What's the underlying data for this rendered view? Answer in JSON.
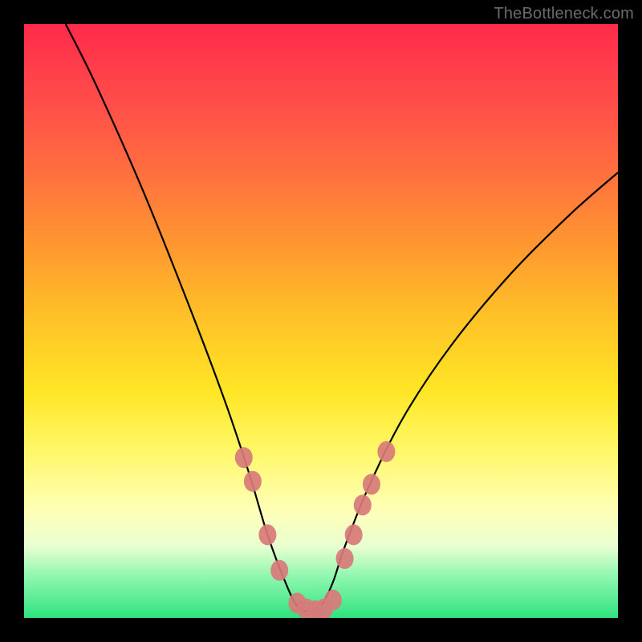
{
  "watermark": "TheBottleneck.com",
  "chart_data": {
    "type": "line",
    "title": "",
    "xlabel": "",
    "ylabel": "",
    "xlim": [
      0,
      100
    ],
    "ylim": [
      0,
      100
    ],
    "series": [
      {
        "name": "bottleneck-curve",
        "x": [
          7,
          12,
          20,
          28,
          34,
          38,
          41,
          44,
          46,
          48,
          50,
          52,
          54,
          58,
          64,
          72,
          82,
          92,
          100
        ],
        "y": [
          100,
          90,
          72,
          52,
          36,
          24,
          14,
          6,
          2,
          1,
          2,
          6,
          12,
          22,
          34,
          46,
          58,
          68,
          75
        ]
      }
    ],
    "markers": {
      "name": "highlighted-points",
      "color": "#d87a7a",
      "points": [
        {
          "x": 37,
          "y": 27
        },
        {
          "x": 38.5,
          "y": 23
        },
        {
          "x": 41,
          "y": 14
        },
        {
          "x": 43,
          "y": 8
        },
        {
          "x": 46,
          "y": 2.5
        },
        {
          "x": 47.5,
          "y": 1.5
        },
        {
          "x": 49,
          "y": 1.2
        },
        {
          "x": 50.5,
          "y": 1.5
        },
        {
          "x": 52,
          "y": 3
        },
        {
          "x": 54,
          "y": 10
        },
        {
          "x": 55.5,
          "y": 14
        },
        {
          "x": 57,
          "y": 19
        },
        {
          "x": 58.5,
          "y": 22.5
        },
        {
          "x": 61,
          "y": 28
        }
      ]
    },
    "gradient_stops": [
      {
        "pos": 0,
        "color": "#ff2a4a"
      },
      {
        "pos": 50,
        "color": "#ffe626"
      },
      {
        "pos": 100,
        "color": "#2fe37e"
      }
    ]
  }
}
